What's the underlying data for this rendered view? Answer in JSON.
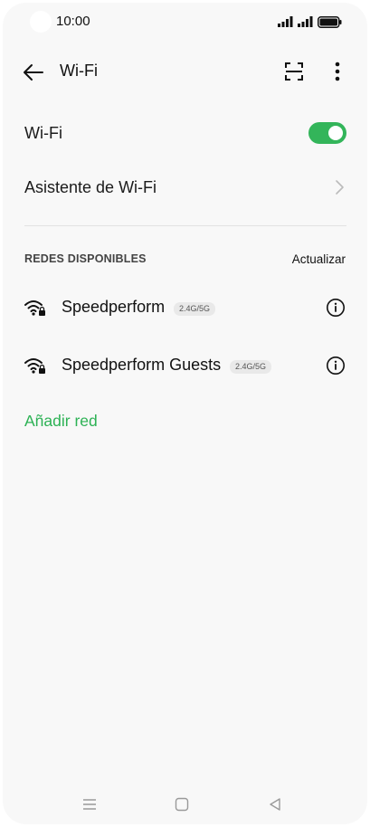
{
  "status_bar": {
    "time": "10:00",
    "icons": [
      "signal-icon",
      "signal-icon",
      "battery-icon"
    ]
  },
  "app_bar": {
    "title": "Wi-Fi",
    "back_icon": "arrow-left-icon",
    "scan_icon": "qr-scan-icon",
    "more_icon": "more-vertical-icon"
  },
  "settings": {
    "wifi_label": "Wi-Fi",
    "wifi_enabled": true,
    "assistant_label": "Asistente de Wi-Fi"
  },
  "networks_section": {
    "header": "REDES DISPONIBLES",
    "refresh_label": "Actualizar",
    "networks": [
      {
        "name": "Speedperform",
        "band": "2.4G/5G",
        "secured": true
      },
      {
        "name": "Speedperform Guests",
        "band": "2.4G/5G",
        "secured": true
      }
    ],
    "add_network_label": "Añadir red"
  },
  "colors": {
    "accent": "#33b55a",
    "background": "#f8f8f8",
    "text": "#1b1b1b"
  },
  "nav_bar": {
    "icons": [
      "menu-icon",
      "home-square-icon",
      "back-triangle-icon"
    ]
  }
}
